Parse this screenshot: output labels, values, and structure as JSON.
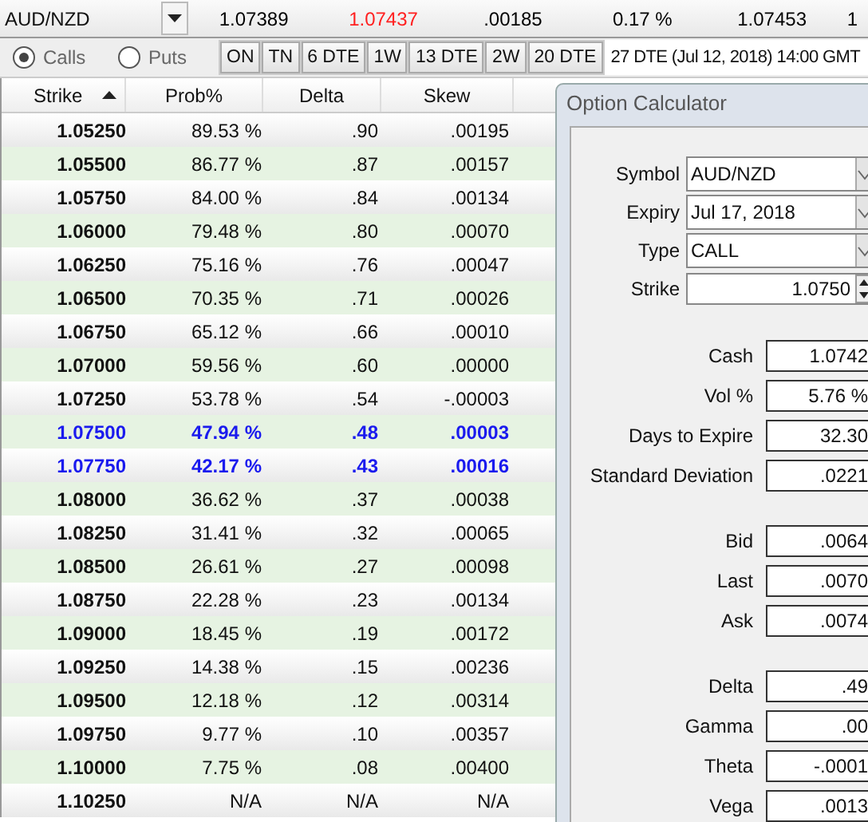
{
  "ticker": {
    "symbol": "AUD/NZD",
    "quotes": [
      {
        "text": "1.07389",
        "color": "#000000"
      },
      {
        "text": "1.07437",
        "color": "#ff2020"
      },
      {
        "text": ".00185",
        "color": "#000000"
      },
      {
        "text": "0.17 %",
        "color": "#000000"
      },
      {
        "text": "1.07453",
        "color": "#000000"
      },
      {
        "text": "1",
        "color": "#000000"
      }
    ]
  },
  "option_type": [
    {
      "label": "Calls",
      "selected": true
    },
    {
      "label": "Puts",
      "selected": false
    }
  ],
  "expiry_buttons": [
    "ON",
    "TN",
    "6 DTE",
    "1W",
    "13 DTE",
    "2W",
    "20 DTE"
  ],
  "expiry_field": "27 DTE (Jul 12, 2018) 14:00 GMT",
  "table": {
    "columns": [
      {
        "label": "Strike",
        "sorted": true
      },
      {
        "label": "Prob%",
        "sorted": false
      },
      {
        "label": "Delta",
        "sorted": false
      },
      {
        "label": "Skew",
        "sorted": false
      }
    ],
    "rows": [
      {
        "cells": [
          "1.05250",
          "89.53 %",
          ".90",
          ".00195"
        ],
        "selected": false
      },
      {
        "cells": [
          "1.05500",
          "86.77 %",
          ".87",
          ".00157"
        ],
        "selected": false
      },
      {
        "cells": [
          "1.05750",
          "84.00 %",
          ".84",
          ".00134"
        ],
        "selected": false
      },
      {
        "cells": [
          "1.06000",
          "79.48 %",
          ".80",
          ".00070"
        ],
        "selected": false
      },
      {
        "cells": [
          "1.06250",
          "75.16 %",
          ".76",
          ".00047"
        ],
        "selected": false
      },
      {
        "cells": [
          "1.06500",
          "70.35 %",
          ".71",
          ".00026"
        ],
        "selected": false
      },
      {
        "cells": [
          "1.06750",
          "65.12 %",
          ".66",
          ".00010"
        ],
        "selected": false
      },
      {
        "cells": [
          "1.07000",
          "59.56 %",
          ".60",
          ".00000"
        ],
        "selected": false
      },
      {
        "cells": [
          "1.07250",
          "53.78 %",
          ".54",
          "-.00003"
        ],
        "selected": false
      },
      {
        "cells": [
          "1.07500",
          "47.94 %",
          ".48",
          ".00003"
        ],
        "selected": true
      },
      {
        "cells": [
          "1.07750",
          "42.17 %",
          ".43",
          ".00016"
        ],
        "selected": true
      },
      {
        "cells": [
          "1.08000",
          "36.62 %",
          ".37",
          ".00038"
        ],
        "selected": false
      },
      {
        "cells": [
          "1.08250",
          "31.41 %",
          ".32",
          ".00065"
        ],
        "selected": false
      },
      {
        "cells": [
          "1.08500",
          "26.61 %",
          ".27",
          ".00098"
        ],
        "selected": false
      },
      {
        "cells": [
          "1.08750",
          "22.28 %",
          ".23",
          ".00134"
        ],
        "selected": false
      },
      {
        "cells": [
          "1.09000",
          "18.45 %",
          ".19",
          ".00172"
        ],
        "selected": false
      },
      {
        "cells": [
          "1.09250",
          "14.38 %",
          ".15",
          ".00236"
        ],
        "selected": false
      },
      {
        "cells": [
          "1.09500",
          "12.18 %",
          ".12",
          ".00314"
        ],
        "selected": false
      },
      {
        "cells": [
          "1.09750",
          "9.77 %",
          ".10",
          ".00357"
        ],
        "selected": false
      },
      {
        "cells": [
          "1.10000",
          "7.75 %",
          ".08",
          ".00400"
        ],
        "selected": false
      },
      {
        "cells": [
          "1.10250",
          "N/A",
          "N/A",
          "N/A"
        ],
        "selected": false
      }
    ]
  },
  "calculator": {
    "title": "Option Calculator",
    "inputs": [
      {
        "label": "Symbol",
        "value": "AUD/NZD",
        "kind": "dropdown"
      },
      {
        "label": "Expiry",
        "value": "Jul 17, 2018",
        "kind": "dropdown"
      },
      {
        "label": "Type",
        "value": "CALL",
        "kind": "dropdown"
      },
      {
        "label": "Strike",
        "value": "1.0750",
        "kind": "spinner"
      }
    ],
    "groups": [
      [
        {
          "label": "Cash",
          "value": "1.0742"
        },
        {
          "label": "Vol %",
          "value": "5.76 %"
        },
        {
          "label": "Days to Expire",
          "value": "32.30"
        },
        {
          "label": "Standard Deviation",
          "value": ".0221"
        }
      ],
      [
        {
          "label": "Bid",
          "value": ".0064"
        },
        {
          "label": "Last",
          "value": ".0070"
        },
        {
          "label": "Ask",
          "value": ".0074"
        }
      ],
      [
        {
          "label": "Delta",
          "value": ".49"
        },
        {
          "label": "Gamma",
          "value": ".00"
        },
        {
          "label": "Theta",
          "value": "-.0001"
        },
        {
          "label": "Vega",
          "value": ".0013"
        }
      ]
    ]
  }
}
